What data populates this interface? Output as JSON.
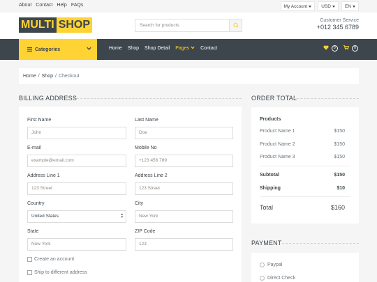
{
  "topbar": {
    "links": [
      "About",
      "Contact",
      "Help",
      "FAQs"
    ],
    "account": "My Account",
    "currency": "USD",
    "language": "EN"
  },
  "header": {
    "logo_part1": "MULTI",
    "logo_part2": "SHOP",
    "search_placeholder": "Search for products",
    "cs_label": "Customer Service",
    "cs_phone": "+012 345 6789"
  },
  "nav": {
    "categories": "Categories",
    "links": [
      "Home",
      "Shop",
      "Shop Detail",
      "Pages",
      "Contact"
    ],
    "active_link": "Pages",
    "wishlist_count": "0",
    "cart_count": "0"
  },
  "breadcrumb": [
    "Home",
    "Shop",
    "Checkout"
  ],
  "billing": {
    "title": "BILLING ADDRESS",
    "first_name_label": "First Name",
    "first_name_ph": "John",
    "last_name_label": "Last Name",
    "last_name_ph": "Doe",
    "email_label": "E-mail",
    "email_ph": "example@email.com",
    "mobile_label": "Mobile No",
    "mobile_ph": "+123 456 789",
    "addr1_label": "Address Line 1",
    "addr1_ph": "123 Street",
    "addr2_label": "Address Line 2",
    "addr2_ph": "123 Street",
    "country_label": "Country",
    "country_value": "United States",
    "city_label": "City",
    "city_ph": "New York",
    "state_label": "State",
    "state_ph": "New York",
    "zip_label": "ZIP Code",
    "zip_ph": "123",
    "create_account": "Create an account",
    "ship_different": "Ship to different address"
  },
  "order": {
    "title": "ORDER TOTAL",
    "products_heading": "Products",
    "items": [
      {
        "name": "Product Name 1",
        "price": "$150"
      },
      {
        "name": "Product Name 2",
        "price": "$150"
      },
      {
        "name": "Product Name 3",
        "price": "$150"
      }
    ],
    "subtotal_label": "Subtotal",
    "subtotal": "$150",
    "shipping_label": "Shipping",
    "shipping": "$10",
    "total_label": "Total",
    "total": "$160"
  },
  "payment": {
    "title": "PAYMENT",
    "options": [
      "Paypal",
      "Direct Check"
    ]
  },
  "colors": {
    "accent": "#ffd333",
    "dark": "#3d464d",
    "background": "#f5f5f5"
  }
}
